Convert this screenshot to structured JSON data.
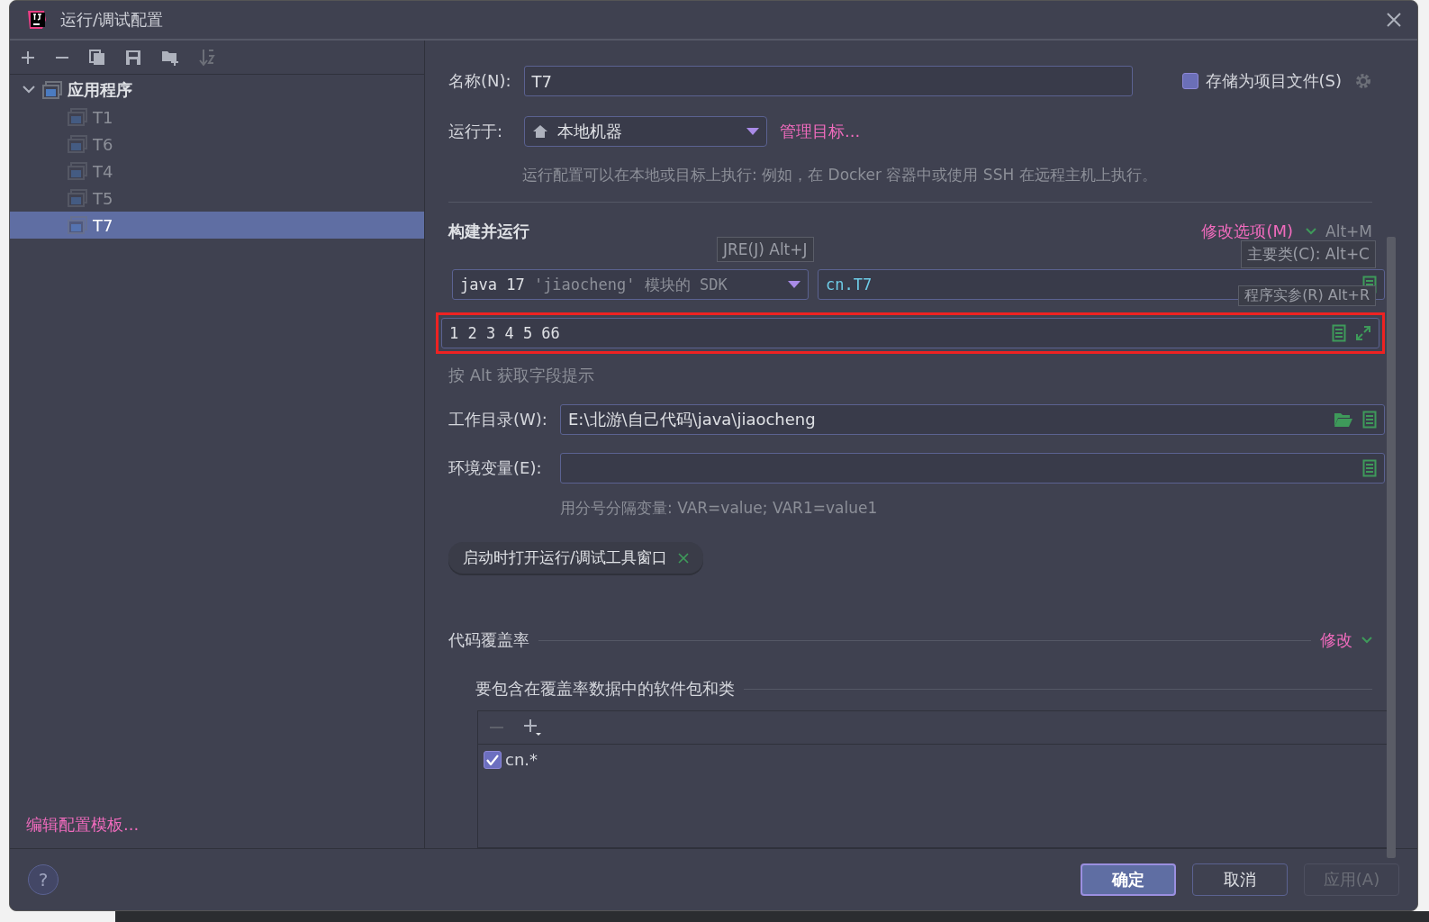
{
  "window": {
    "title": "运行/调试配置"
  },
  "tree": {
    "items": [
      {
        "label": "应用程序",
        "expanded": true,
        "children": [
          {
            "label": "T1",
            "selected": false
          },
          {
            "label": "T6",
            "selected": false
          },
          {
            "label": "T4",
            "selected": false
          },
          {
            "label": "T5",
            "selected": false
          },
          {
            "label": "T7",
            "selected": true
          }
        ]
      }
    ]
  },
  "edit_templates_link": "编辑配置模板...",
  "name": {
    "label": "名称(N):",
    "value": "T7"
  },
  "store_file": {
    "label": "存储为项目文件(S)",
    "checked": false
  },
  "run_on": {
    "label": "运行于:",
    "value": "本地机器",
    "link": "管理目标...",
    "hint": "运行配置可以在本地或目标上执行: 例如，在 Docker 容器中或使用 SSH 在远程主机上执行。"
  },
  "build_run": {
    "title": "构建并运行",
    "modify_options": "修改选项(M)",
    "shortcut": "Alt+M",
    "jre": {
      "value": "java 17",
      "hint": "'jiaocheng' 模块的 SDK"
    },
    "main_class": "cn.T7",
    "args": {
      "value": "1 2 3 4 5 66",
      "highlighted": true
    },
    "tooltips": [
      "JRE(J) Alt+J",
      "主要类(C): Alt+C",
      "程序实参(R) Alt+R"
    ],
    "alt_hint": "按 Alt 获取字段提示"
  },
  "workdir": {
    "label": "工作目录(W):",
    "value": "E:\\北游\\自己代码\\java\\jiaocheng"
  },
  "env": {
    "label": "环境变量(E):",
    "hint": "用分号分隔变量: VAR=value; VAR1=value1"
  },
  "chips": [
    {
      "label": "启动时打开运行/调试工具窗口"
    }
  ],
  "coverage": {
    "title": "代码覆盖率",
    "modify": "修改",
    "subtitle": "要包含在覆盖率数据中的软件包和类",
    "items": [
      {
        "label": "cn.*",
        "checked": true
      }
    ]
  },
  "help": "?",
  "buttons": [
    {
      "label": "确定",
      "kind": "primary"
    },
    {
      "label": "取消",
      "kind": "normal"
    },
    {
      "label": "应用(A)",
      "kind": "disabled"
    }
  ]
}
